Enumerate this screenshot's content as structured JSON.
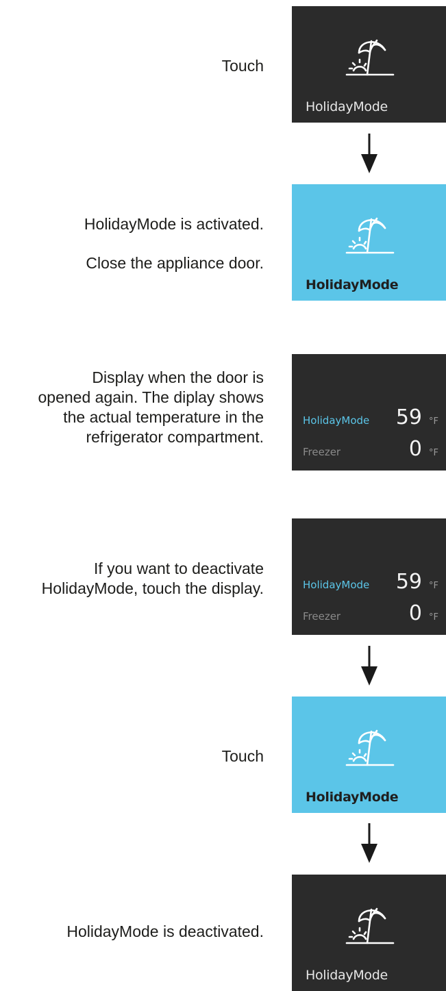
{
  "colors": {
    "panel_dark": "#2b2b2b",
    "panel_active": "#5bc5e8",
    "highlight_text": "#5bc5e8"
  },
  "icons": {
    "holiday": "umbrella-sun-icon",
    "arrow": "arrow-down-icon"
  },
  "steps": [
    {
      "text": [
        "Touch"
      ],
      "panel": {
        "label": "HolidayMode"
      }
    },
    {
      "text": [
        "HolidayMode is activated.",
        "Close the appliance door."
      ],
      "panel": {
        "label": "HolidayMode"
      }
    },
    {
      "text": [
        "Display when the door is",
        "opened again. The diplay shows",
        "the actual temperature in the",
        "refrigerator compartment."
      ],
      "display": {
        "rows": [
          {
            "name": "HolidayMode",
            "value": "59",
            "unit": "°F"
          },
          {
            "name": "Freezer",
            "value": "0",
            "unit": "°F"
          }
        ]
      }
    },
    {
      "text": [
        "If you want to deactivate",
        "HolidayMode, touch the display."
      ],
      "display": {
        "rows": [
          {
            "name": "HolidayMode",
            "value": "59",
            "unit": "°F"
          },
          {
            "name": "Freezer",
            "value": "0",
            "unit": "°F"
          }
        ]
      }
    },
    {
      "text": [
        "Touch"
      ],
      "panel": {
        "label": "HolidayMode"
      }
    },
    {
      "text": [
        "HolidayMode is deactivated."
      ],
      "panel": {
        "label": "HolidayMode"
      }
    }
  ]
}
